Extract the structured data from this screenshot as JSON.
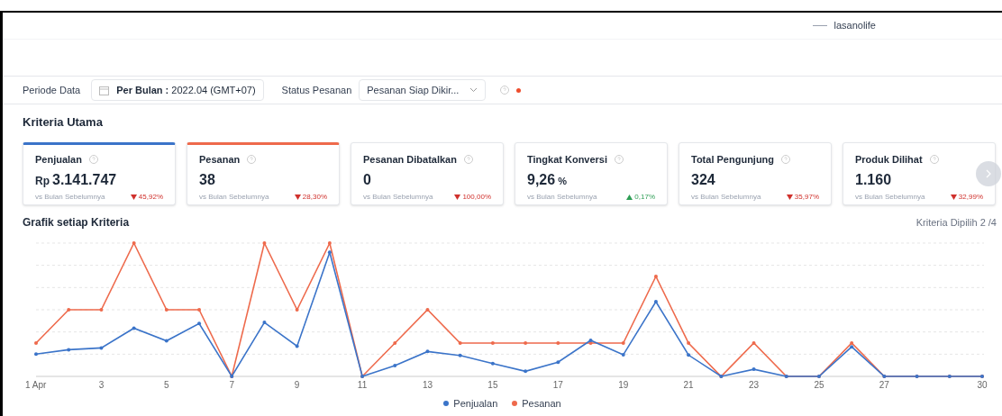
{
  "header": {
    "account": "lasanolife"
  },
  "filters": {
    "period_label": "Periode Data",
    "period_value": "**Per Bulan :** 2022.04 (GMT+07)",
    "status_label": "Status Pesanan",
    "status_value": "Pesanan Siap Dikir..."
  },
  "section_title": "Kriteria Utama",
  "metrics": [
    {
      "title": "Penjualan",
      "prefix": "Rp",
      "value": "3.141.747",
      "compare": "vs Bulan Sebelumnya",
      "change": "45,92%",
      "kind": "decrease",
      "selected": true,
      "color": "#3b74c9"
    },
    {
      "title": "Pesanan",
      "value": "38",
      "compare": "vs Bulan Sebelumnya",
      "change": "28,30%",
      "kind": "decrease",
      "selected": true,
      "color": "#ee6a4c"
    },
    {
      "title": "Pesanan Dibatalkan",
      "value": "0",
      "compare": "vs Bulan Sebelumnya",
      "change": "100,00%",
      "kind": "decrease",
      "selected": false
    },
    {
      "title": "Tingkat Konversi",
      "value": "9,26",
      "suffix": "%",
      "compare": "vs Bulan Sebelumnya",
      "change": "0,17%",
      "kind": "increase",
      "selected": false
    },
    {
      "title": "Total Pengunjung",
      "value": "324",
      "compare": "vs Bulan Sebelumnya",
      "change": "35,97%",
      "kind": "decrease",
      "selected": false
    },
    {
      "title": "Produk Dilihat",
      "value": "1.160",
      "compare": "vs Bulan Sebelumnya",
      "change": "32,99%",
      "kind": "decrease",
      "selected": false
    }
  ],
  "chart": {
    "title": "Grafik setiap Kriteria",
    "selection": "Kriteria Dipilih 2 /4",
    "xticks": [
      "1 Apr",
      "3",
      "5",
      "7",
      "9",
      "11",
      "13",
      "15",
      "17",
      "19",
      "21",
      "23",
      "25",
      "27",
      "30"
    ],
    "legend": [
      {
        "name": "Penjualan",
        "color": "#3b74c9"
      },
      {
        "name": "Pesanan",
        "color": "#ee6a4c"
      }
    ]
  }
}
